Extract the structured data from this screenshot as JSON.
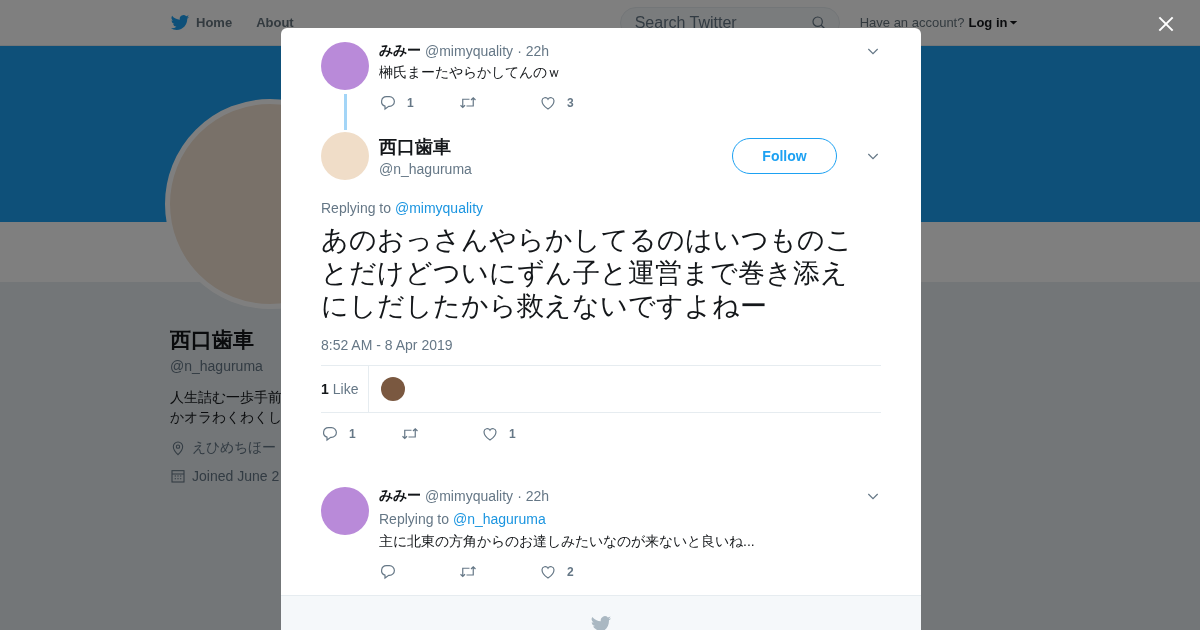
{
  "nav": {
    "items": [
      "Home",
      "About"
    ],
    "search": {
      "placeholder": "Search Twitter"
    },
    "account_prompt": "Have an account?",
    "login": "Log in"
  },
  "profile": {
    "name": "西口歯車",
    "handle": "@n_haguruma",
    "bio_lines": [
      "人生詰む一歩手前",
      "かオラわくわくし"
    ],
    "location": "えひめちほー",
    "joined": "Joined June 2"
  },
  "modal": {
    "parent_tweet": {
      "name": "みみー",
      "handle": "@mimyquality",
      "separator": "·",
      "time": "22h",
      "text": "榊氏まーたやらかしてんのｗ",
      "reply_count": "1",
      "like_count": "3"
    },
    "tweet": {
      "name": "西口歯車",
      "handle": "@n_haguruma",
      "follow": "Follow",
      "replying_label": "Replying to",
      "replying_to": "@mimyquality",
      "text": "あのおっさんやらかしてるのはいつものことだけどついにずん子と運営まで巻き添えにしだしたから救えないですよねー",
      "timestamp": "8:52 AM - 8 Apr 2019",
      "likes_count": "1",
      "likes_label": "Like",
      "reply_count": "1",
      "like_count": "1"
    },
    "replies": [
      {
        "name": "みみー",
        "handle": "@mimyquality",
        "separator": "·",
        "time": "22h",
        "replying_label": "Replying to",
        "replying_to": "@n_haguruma",
        "text": "主に北東の方角からのお達しみたいなのが来ないと良いね...",
        "like_count": "2"
      }
    ]
  }
}
